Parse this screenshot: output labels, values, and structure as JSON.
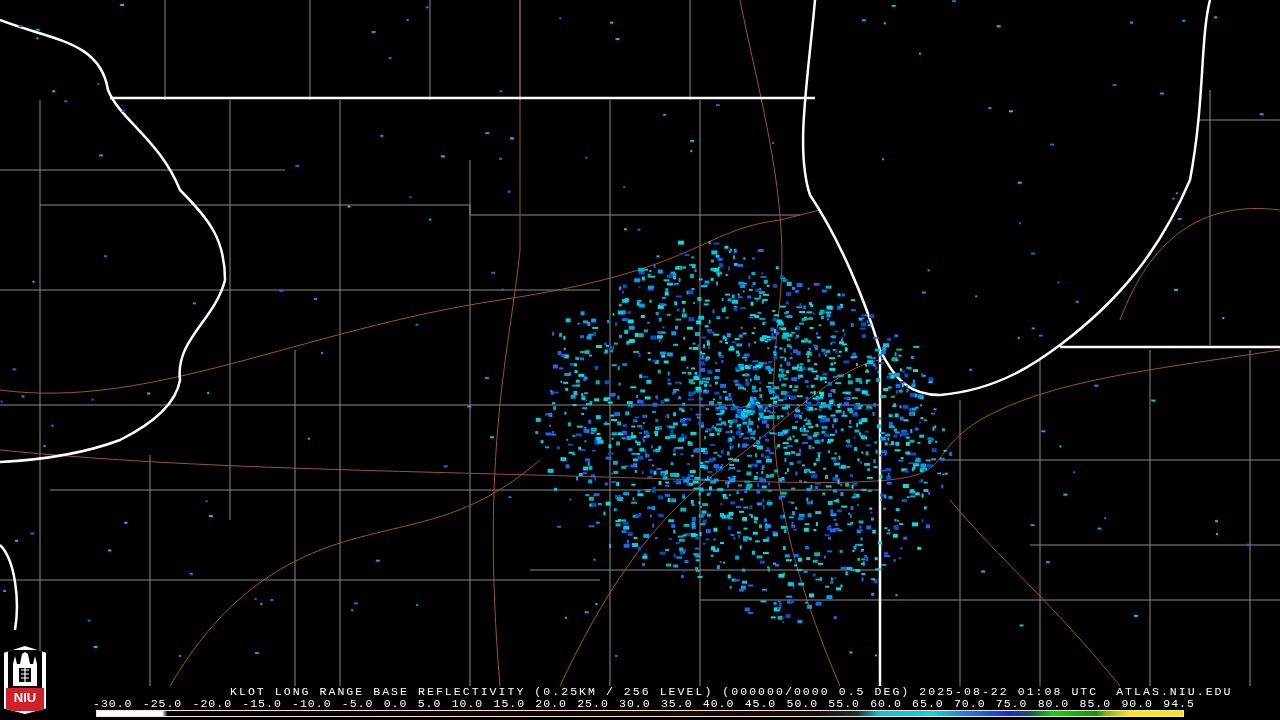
{
  "caption": "KLOT LONG RANGE BASE REFLECTIVITY (0.25KM / 256 LEVEL) (000000/0000 0.5 DEG) 2025-08-22 01:08 UTC  ATLAS.NIU.EDU",
  "logo": {
    "text": "NIU"
  },
  "scale_labels": [
    "-30.0",
    "-25.0",
    "-20.0",
    "-15.0",
    "-10.0",
    "-5.0",
    "0.0",
    "5.0",
    "10.0",
    "15.0",
    "20.0",
    "25.0",
    "30.0",
    "35.0",
    "40.0",
    "45.0",
    "50.0",
    "55.0",
    "60.0",
    "65.0",
    "70.0",
    "75.0",
    "80.0",
    "85.0",
    "90.0",
    "94.5"
  ]
}
